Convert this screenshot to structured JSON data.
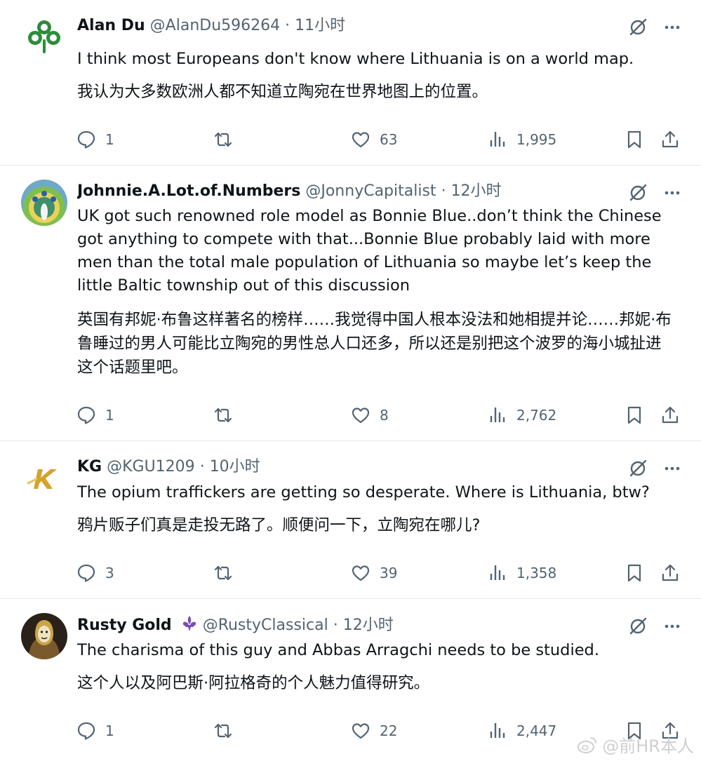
{
  "tweets": [
    {
      "name": "Alan Du",
      "handle": "@AlanDu596264",
      "dot": "·",
      "time": "11小时",
      "text_en": "I think most Europeans don't know where Lithuania is on a world map.",
      "text_zh": "我认为大多数欧洲人都不知道立陶宛在世界地图上的位置。",
      "replies": "1",
      "retweets": "",
      "likes": "63",
      "views": "1,995",
      "avatar_icon": "clover-icon"
    },
    {
      "name": "Johnnie.A.Lot.of.Numbers",
      "handle": "@JonnyCapitalist",
      "dot": "·",
      "time": "12小时",
      "text_en": "UK got such renowned role model as Bonnie Blue..don’t think the Chinese got anything to compete with that...Bonnie Blue probably laid with more men than the total male population of Lithuania so maybe let’s keep the little Baltic township out of this discussion",
      "text_zh": "英国有邦妮·布鲁这样著名的榜样……我觉得中国人根本没法和她相提并论……邦妮·布鲁睡过的男人可能比立陶宛的男性总人口还多，所以还是别把这个波罗的海小城扯进这个话题里吧。",
      "replies": "1",
      "retweets": "",
      "likes": "8",
      "views": "2,762",
      "avatar_icon": "peacock-icon"
    },
    {
      "name": "KG",
      "handle": "@KGU1209",
      "dot": "·",
      "time": "10小时",
      "text_en": "The opium traffickers are getting so desperate. Where is Lithuania, btw?",
      "text_zh": "鸦片贩子们真是走投无路了。顺便问一下，立陶宛在哪儿?",
      "replies": "3",
      "retweets": "",
      "likes": "39",
      "views": "1,358",
      "avatar_icon": "k-logo-icon"
    },
    {
      "name": "Rusty Gold",
      "handle": "@RustyClassical",
      "dot": "·",
      "time": "12小时",
      "text_en": "The charisma of this guy and Abbas Arragchi needs to be studied.",
      "text_zh": "这个人以及阿巴斯·阿拉格奇的个人魅力值得研究。",
      "replies": "1",
      "retweets": "",
      "likes": "22",
      "views": "2,447",
      "avatar_icon": "masked-figure-icon",
      "name_badge_icon": "fleur-de-lis-icon"
    }
  ],
  "watermark": {
    "text": "@前HR本人",
    "icon": "weibo-icon"
  },
  "colors": {
    "text": "#0f1419",
    "secondary": "#536471",
    "divider": "#e6ecf0",
    "badge": "#7b4db5"
  }
}
